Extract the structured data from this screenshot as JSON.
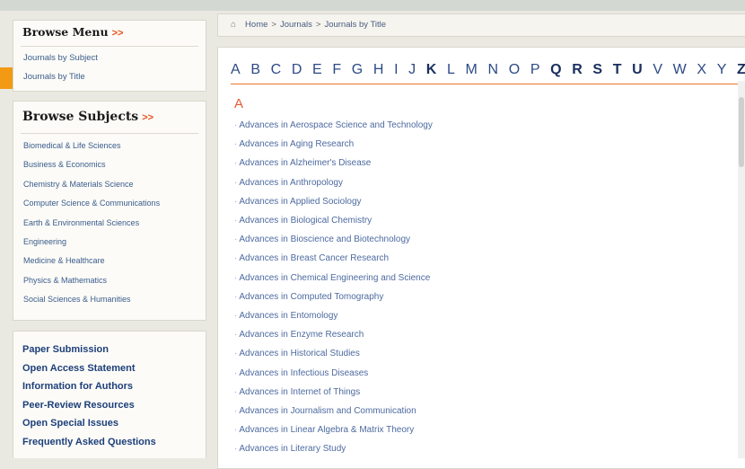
{
  "browse_menu": {
    "title": "Browse Menu",
    "arrow": ">>",
    "items": [
      "Journals by Subject",
      "Journals by Title"
    ]
  },
  "browse_subjects": {
    "title": "Browse Subjects",
    "arrow": ">>",
    "items": [
      "Biomedical & Life Sciences",
      "Business & Economics",
      "Chemistry & Materials Science",
      "Computer Science & Communications",
      "Earth & Environmental Sciences",
      "Engineering",
      "Medicine & Healthcare",
      "Physics & Mathematics",
      "Social Sciences & Humanities"
    ]
  },
  "info_links": [
    "Paper Submission",
    "Open Access Statement",
    "Information for Authors",
    "Peer-Review Resources",
    "Open Special Issues",
    "Frequently Asked Questions"
  ],
  "breadcrumb": {
    "home_icon": "home-icon",
    "items": [
      "Home",
      "Journals",
      "Journals by Title"
    ],
    "separator": ">"
  },
  "alphabet": [
    "A",
    "B",
    "C",
    "D",
    "E",
    "F",
    "G",
    "H",
    "I",
    "J",
    "K",
    "L",
    "M",
    "N",
    "O",
    "P",
    "Q",
    "R",
    "S",
    "T",
    "U",
    "V",
    "W",
    "X",
    "Y",
    "Z"
  ],
  "section_letter": "A",
  "journals": [
    "Advances in Aerospace Science and Technology",
    "Advances in Aging Research",
    "Advances in Alzheimer's Disease",
    "Advances in Anthropology",
    "Advances in Applied Sociology",
    "Advances in Biological Chemistry",
    "Advances in Bioscience and Biotechnology",
    "Advances in Breast Cancer Research",
    "Advances in Chemical Engineering and Science",
    "Advances in Computed Tomography",
    "Advances in Entomology",
    "Advances in Enzyme Research",
    "Advances in Historical Studies",
    "Advances in Infectious Diseases",
    "Advances in Internet of Things",
    "Advances in Journalism and Communication",
    "Advances in Linear Algebra & Matrix Theory",
    "Advances in Literary Study"
  ],
  "colors": {
    "accent": "#e8762d",
    "link": "#4d6aa0",
    "heading": "#1d3f7a"
  }
}
